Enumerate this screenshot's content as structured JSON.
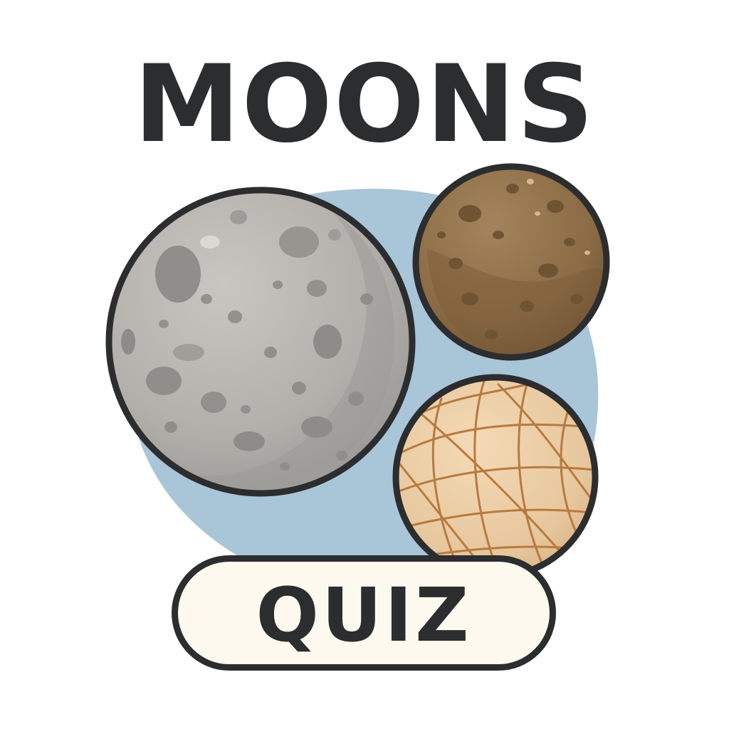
{
  "title": "MOONS",
  "button": {
    "label": "QUIZ"
  },
  "icons": [
    "grey-moon-icon",
    "brown-moon-icon",
    "tan-striped-moon-icon"
  ],
  "colors": {
    "text": "#2c2d2f",
    "backdrop": "#a9c5d8",
    "button_fill": "#fdf9ee",
    "grey_moon": "#b3b0ad",
    "brown_moon": "#8c6d45",
    "tan_moon": "#e5c49a",
    "tan_stripes": "#b87a3f"
  }
}
